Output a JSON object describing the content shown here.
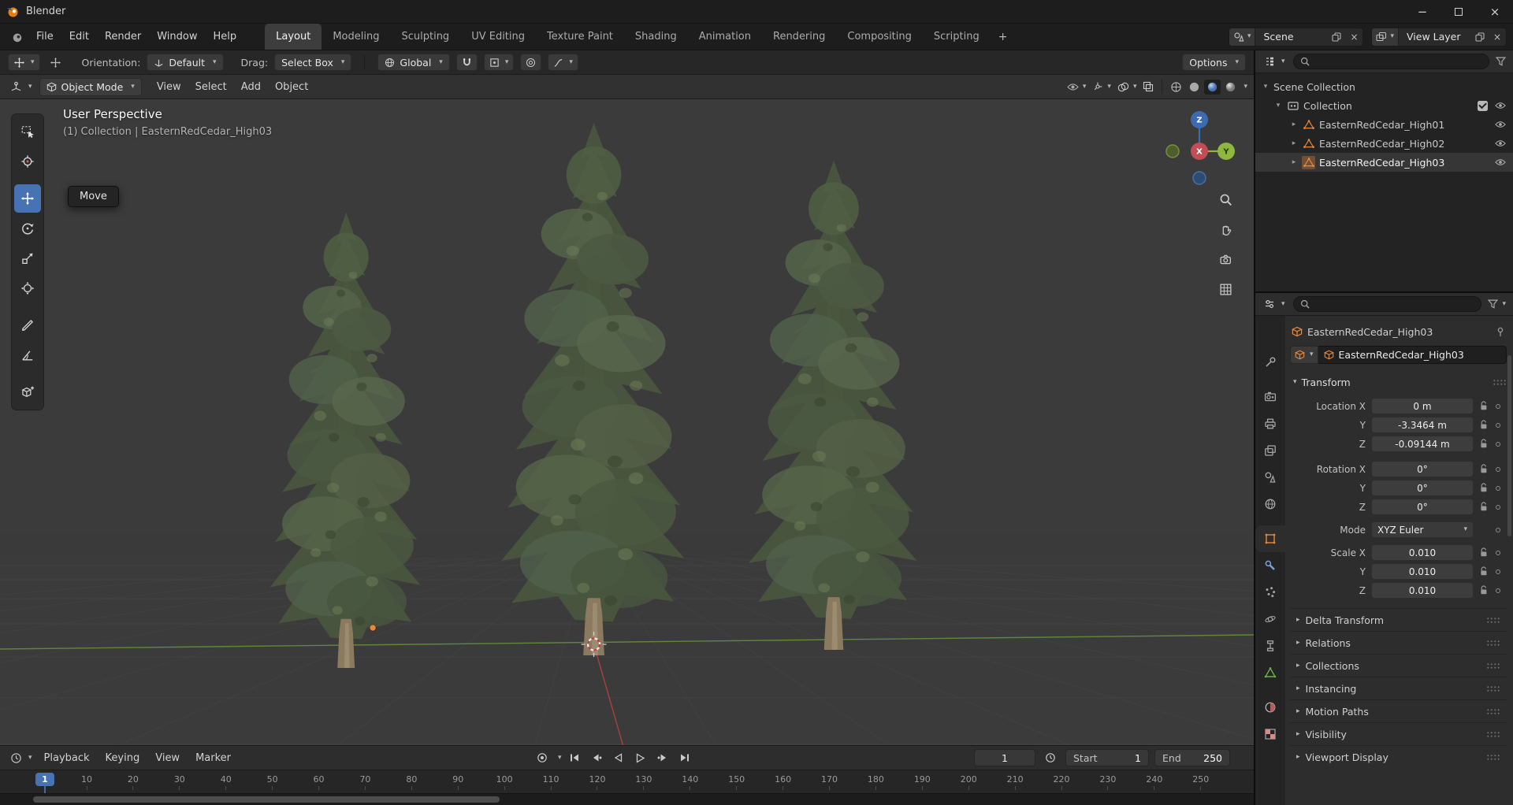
{
  "window": {
    "title": "Blender"
  },
  "glyphs": {
    "minimize": "−",
    "maximize": "□",
    "close": "×",
    "caret_down": "▾",
    "caret_right": "▸",
    "unlink": "×",
    "add": "+"
  },
  "topbar": {
    "menus": [
      "File",
      "Edit",
      "Render",
      "Window",
      "Help"
    ],
    "workspaces": [
      {
        "label": "Layout",
        "active": true
      },
      {
        "label": "Modeling"
      },
      {
        "label": "Sculpting"
      },
      {
        "label": "UV Editing"
      },
      {
        "label": "Texture Paint"
      },
      {
        "label": "Shading"
      },
      {
        "label": "Animation"
      },
      {
        "label": "Rendering"
      },
      {
        "label": "Compositing"
      },
      {
        "label": "Scripting"
      }
    ],
    "add_tab": "+",
    "scene_name": "Scene",
    "view_layer_name": "View Layer"
  },
  "tool_settings": {
    "orientation_label": "Orientation:",
    "orientation_value": "Default",
    "drag_label": "Drag:",
    "drag_value": "Select Box",
    "pivot_value": "Global",
    "options_label": "Options"
  },
  "viewport": {
    "header": {
      "mode": "Object Mode",
      "menus": [
        "View",
        "Select",
        "Add",
        "Object"
      ]
    },
    "overlay_line1": "User Perspective",
    "overlay_line2": "(1) Collection | EasternRedCedar_High03",
    "tooltip": "Move",
    "axis": {
      "x": "X",
      "y": "Y",
      "z": "Z"
    },
    "tools": [
      {
        "name": "select-box"
      },
      {
        "name": "cursor"
      },
      {
        "name": "move",
        "active": true
      },
      {
        "name": "rotate"
      },
      {
        "name": "scale"
      },
      {
        "name": "transform"
      },
      {
        "name": "annotate"
      },
      {
        "name": "measure"
      },
      {
        "name": "add-cube"
      }
    ],
    "shading_modes": [
      "wireframe",
      "solid",
      "material-preview",
      "rendered"
    ],
    "active_shading": "material-preview"
  },
  "outliner": {
    "root": "Scene Collection",
    "collection": "Collection",
    "objects": [
      {
        "name": "EasternRedCedar_High01"
      },
      {
        "name": "EasternRedCedar_High02"
      },
      {
        "name": "EasternRedCedar_High03",
        "active": true
      }
    ]
  },
  "properties": {
    "breadcrumb": "EasternRedCedar_High03",
    "object_name": "Eas­ternRedCedar_High03",
    "transform_title": "Transform",
    "rows": [
      {
        "label": "Location X",
        "value": "0 m"
      },
      {
        "label": "Y",
        "value": "-3.3464 m"
      },
      {
        "label": "Z",
        "value": "-0.09144 m"
      },
      {
        "label": "Rotation X",
        "value": "0°"
      },
      {
        "label": "Y",
        "value": "0°"
      },
      {
        "label": "Z",
        "value": "0°"
      },
      {
        "label": "Mode",
        "value": "XYZ Euler"
      },
      {
        "label": "Scale X",
        "value": "0.010"
      },
      {
        "label": "Y",
        "value": "0.010"
      },
      {
        "label": "Z",
        "value": "0.010"
      }
    ],
    "sections": [
      "Delta Transform",
      "Relations",
      "Collections",
      "Instancing",
      "Motion Paths",
      "Visibility",
      "Viewport Display"
    ],
    "tabs": [
      {
        "name": "tool"
      },
      {
        "name": "render"
      },
      {
        "name": "output"
      },
      {
        "name": "view-layer"
      },
      {
        "name": "scene"
      },
      {
        "name": "world"
      },
      {
        "name": "object",
        "active": true
      },
      {
        "name": "modifiers"
      },
      {
        "name": "particles"
      },
      {
        "name": "physics"
      },
      {
        "name": "constraints"
      },
      {
        "name": "object-data"
      },
      {
        "name": "material"
      },
      {
        "name": "texture"
      }
    ]
  },
  "timeline": {
    "menus": [
      "Playback",
      "Keying",
      "View",
      "Marker"
    ],
    "playhead": "1",
    "current_frame": "1",
    "start_label": "Start",
    "start_value": "1",
    "end_label": "End",
    "end_value": "250",
    "ticks": [
      "10",
      "20",
      "30",
      "40",
      "50",
      "60",
      "70",
      "80",
      "90",
      "100",
      "110",
      "120",
      "130",
      "140",
      "150",
      "160",
      "170",
      "180",
      "190",
      "200",
      "210",
      "220",
      "230",
      "240",
      "250"
    ]
  },
  "colors": {
    "accent": "#4772b3",
    "object_active": "#e8883b",
    "axis_x": "#c24d52",
    "axis_y": "#8db73e",
    "axis_z": "#3d6bb2"
  }
}
